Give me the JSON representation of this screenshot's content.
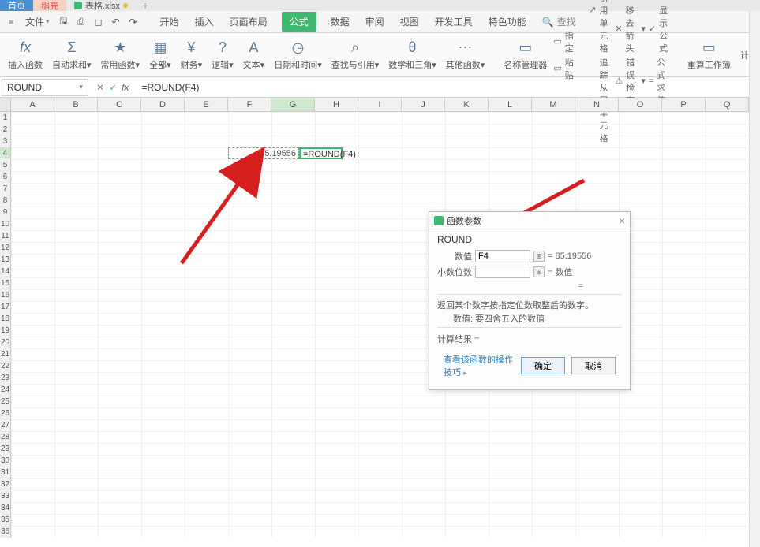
{
  "tabs": {
    "home": "首页",
    "dao": "稻壳",
    "file": "表格.xlsx",
    "plus": "+"
  },
  "menu": {
    "file": "文件",
    "items": [
      "开始",
      "插入",
      "页面布局",
      "公式",
      "数据",
      "审阅",
      "视图",
      "开发工具",
      "特色功能"
    ],
    "search": "查找"
  },
  "ribbon": {
    "groups": [
      {
        "icon": "fx",
        "label": "插入函数"
      },
      {
        "icon": "Σ",
        "label": "自动求和"
      },
      {
        "icon": "★",
        "label": "常用函数"
      },
      {
        "icon": "▦",
        "label": "全部"
      },
      {
        "icon": "¥",
        "label": "财务"
      },
      {
        "icon": "?",
        "label": "逻辑"
      },
      {
        "icon": "A",
        "label": "文本"
      },
      {
        "icon": "◷",
        "label": "日期和时间"
      },
      {
        "icon": "⌕",
        "label": "查找与引用"
      },
      {
        "icon": "θ",
        "label": "数学和三角"
      },
      {
        "icon": "⋯",
        "label": "其他函数"
      }
    ],
    "name_mgr": "名称管理器",
    "small1": [
      {
        "label": "指定"
      },
      {
        "label": "粘贴"
      }
    ],
    "small2": [
      {
        "label": "追踪引用单元格"
      },
      {
        "label": "追踪从属单元格"
      }
    ],
    "small3": [
      {
        "label": "移去箭头"
      },
      {
        "label": "错误检查"
      }
    ],
    "small4": [
      {
        "label": "显示公式"
      },
      {
        "label": "公式求值"
      }
    ],
    "calc": "重算工作簿",
    "calc2": "计算"
  },
  "formula_bar": {
    "name": "ROUND",
    "formula": "=ROUND(F4)"
  },
  "columns": [
    "A",
    "B",
    "C",
    "D",
    "E",
    "F",
    "G",
    "H",
    "I",
    "J",
    "K",
    "L",
    "M",
    "N",
    "O",
    "P",
    "Q"
  ],
  "cells": {
    "f4": "85.19556",
    "g4": "=ROUND(F4)"
  },
  "dialog": {
    "title": "函数参数",
    "func": "ROUND",
    "param1_label": "数值",
    "param1_value": "F4",
    "param1_result": "= 85.19556",
    "param2_label": "小数位数",
    "param2_value": "",
    "param2_result": "= 数值",
    "eq": "=",
    "desc1": "返回某个数字按指定位数取整后的数字。",
    "desc2": "数值: 要四舍五入的数值",
    "result": "计算结果 =",
    "link": "查看该函数的操作技巧",
    "ok": "确定",
    "cancel": "取消"
  }
}
